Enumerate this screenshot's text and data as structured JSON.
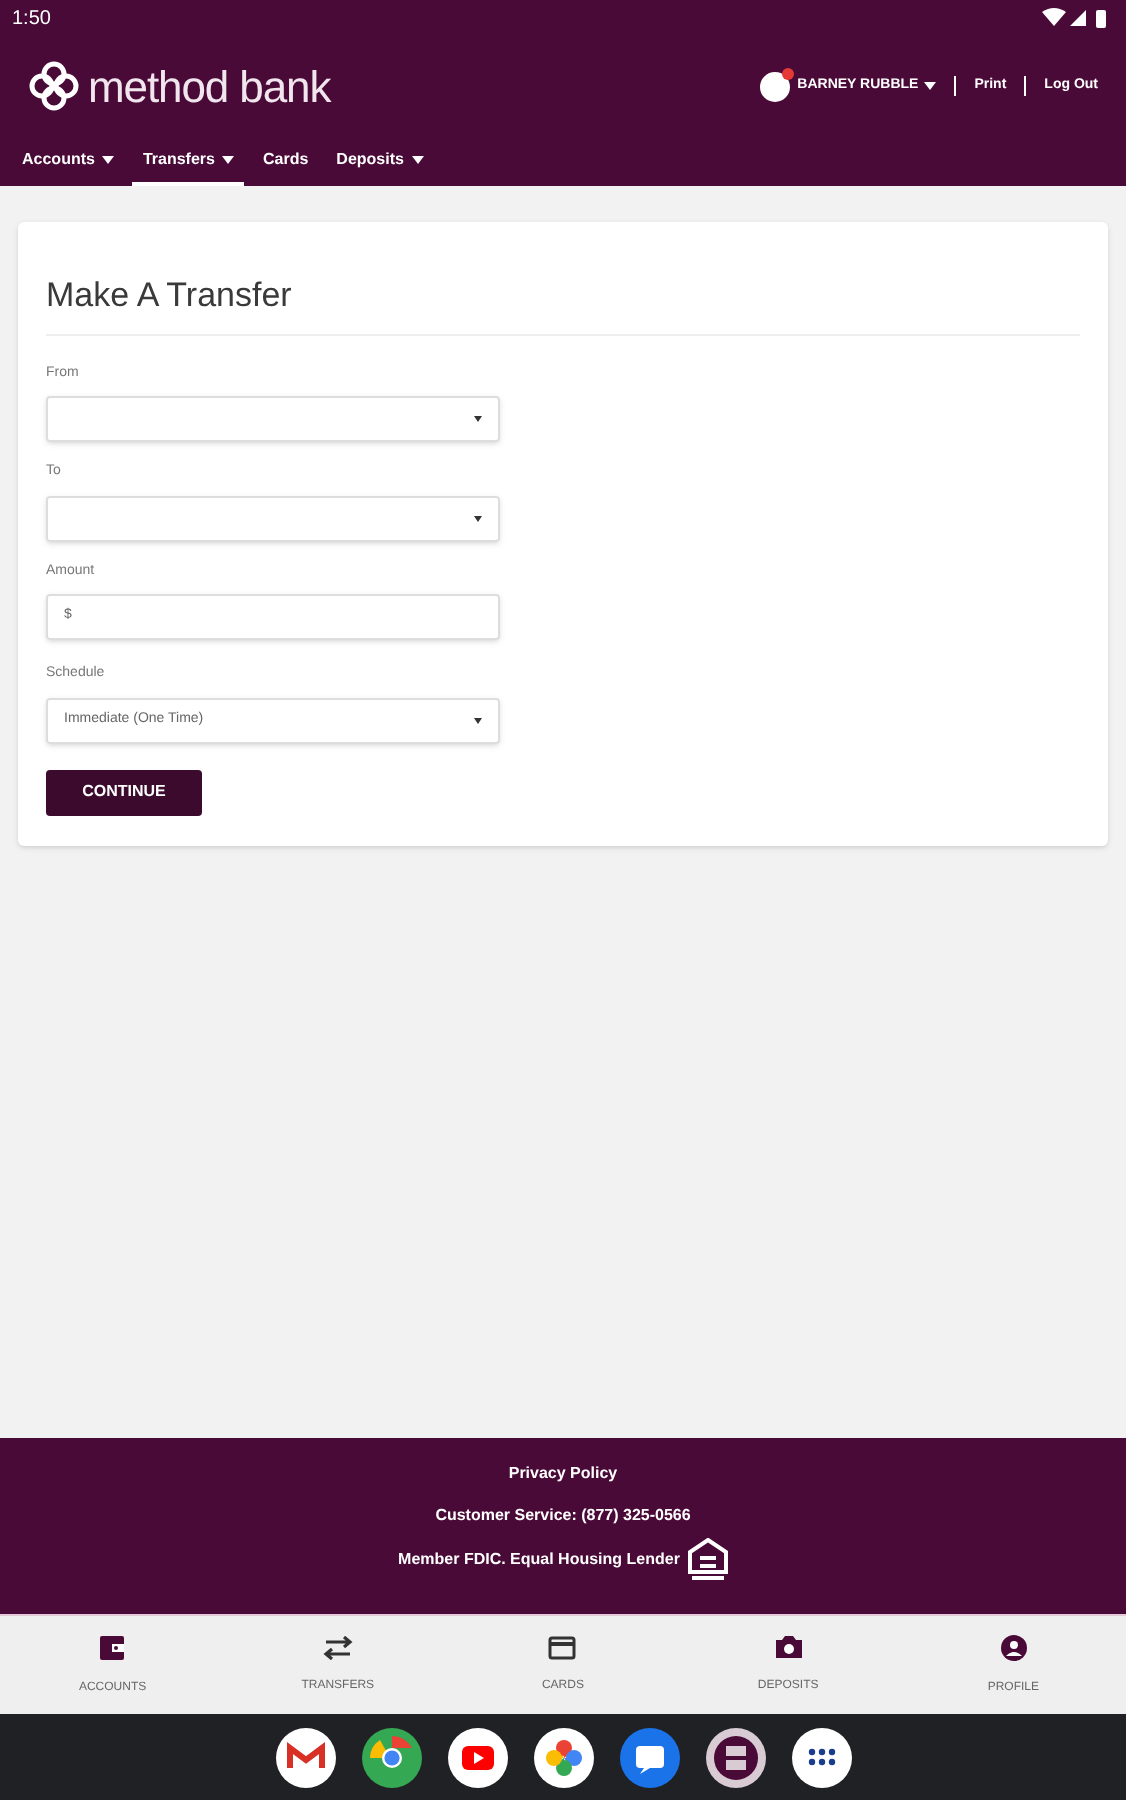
{
  "status_bar": {
    "time": "1:50"
  },
  "header": {
    "logo": "method bank",
    "user": "BARNEY RUBBLE",
    "links": [
      "Print",
      "Log Out"
    ]
  },
  "nav": [
    {
      "label": "Accounts",
      "dropdown": true,
      "selected": false
    },
    {
      "label": "Transfers",
      "dropdown": true,
      "selected": true
    },
    {
      "label": "Cards",
      "dropdown": false,
      "selected": false
    },
    {
      "label": "Deposits",
      "dropdown": true,
      "selected": false
    }
  ],
  "form": {
    "title": "Make A Transfer",
    "fields": [
      {
        "kind": "select",
        "label": "From"
      },
      {
        "kind": "select",
        "label": "To"
      },
      {
        "kind": "input",
        "label": "Amount",
        "value": "$"
      },
      {
        "kind": "select",
        "label": "Schedule",
        "value": "Immediate (One Time)"
      }
    ],
    "button": "CONTINUE"
  },
  "footer": {
    "links": [
      "Privacy Policy"
    ],
    "lines": [
      "Customer Service: (877) 325-0566",
      "Member FDIC. Equal Housing Lender"
    ]
  },
  "bottom_nav": [
    {
      "kind": "wallet",
      "label": "ACCOUNTS"
    },
    {
      "kind": "swap",
      "label": "TRANSFERS"
    },
    {
      "kind": "card",
      "label": "CARDS"
    },
    {
      "kind": "camera",
      "label": "DEPOSITS"
    },
    {
      "kind": "person",
      "label": "PROFILE"
    }
  ],
  "dock": [
    {
      "kind": "mail"
    },
    {
      "kind": "browser"
    },
    {
      "kind": "video"
    },
    {
      "kind": "photos"
    },
    {
      "kind": "messages"
    },
    {
      "kind": "bank"
    },
    {
      "kind": "apps"
    }
  ]
}
